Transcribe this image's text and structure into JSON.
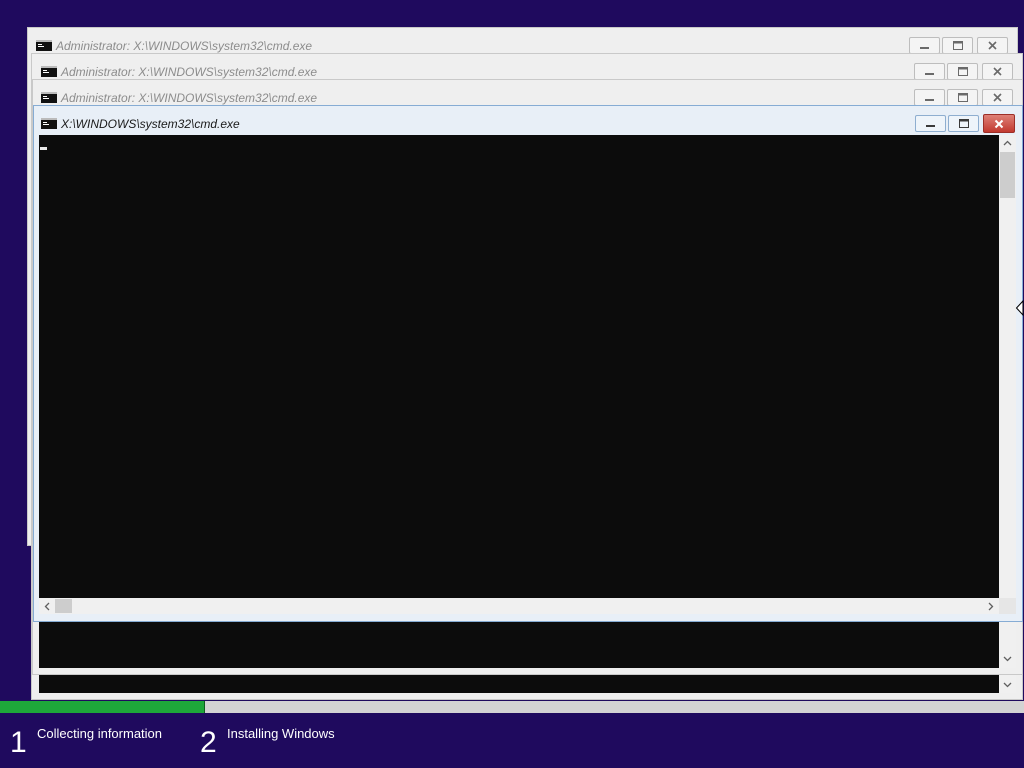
{
  "screen": {
    "background_color": "#1f0a5e"
  },
  "windows": [
    {
      "title": "Administrator: X:\\WINDOWS\\system32\\cmd.exe",
      "active": false
    },
    {
      "title": "Administrator: X:\\WINDOWS\\system32\\cmd.exe",
      "active": false
    },
    {
      "title": "Administrator: X:\\WINDOWS\\system32\\cmd.exe",
      "active": false
    },
    {
      "title": "X:\\WINDOWS\\system32\\cmd.exe",
      "active": true
    }
  ],
  "icons": {
    "app": "cmd-icon",
    "minimize": "minimize-icon",
    "maximize": "maximize-icon",
    "close": "close-icon",
    "scroll_up": "chevron-up-icon",
    "scroll_down": "chevron-down-icon",
    "scroll_left": "chevron-left-icon",
    "scroll_right": "chevron-right-icon",
    "pointer": "resize-cursor-icon"
  },
  "colors": {
    "console": "#0c0c0c",
    "close_button": "#c9463d"
  },
  "setup_progress": {
    "percent": 20,
    "fill_color": "#1ea73a",
    "steps": [
      {
        "number": "1",
        "label": "Collecting information"
      },
      {
        "number": "2",
        "label": "Installing Windows"
      }
    ]
  }
}
